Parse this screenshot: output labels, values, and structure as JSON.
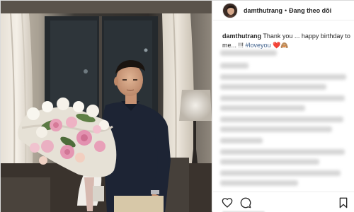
{
  "post": {
    "username": "damthutrang",
    "separator": "•",
    "follow_label": "Đang theo dõi"
  },
  "caption": {
    "username": "damthutrang",
    "text": " Thank you ... happy birthday to me... !!! ",
    "hashtag": "#loveyou",
    "emoji": " ❤️🙈"
  },
  "actions": {
    "like_icon": "heart-icon",
    "comment_icon": "comment-icon",
    "save_icon": "bookmark-icon"
  },
  "colors": {
    "text": "#262626",
    "hashtag": "#3d5f8b",
    "border": "#dbdbdb",
    "blurred_text": "#cfcfcf"
  }
}
